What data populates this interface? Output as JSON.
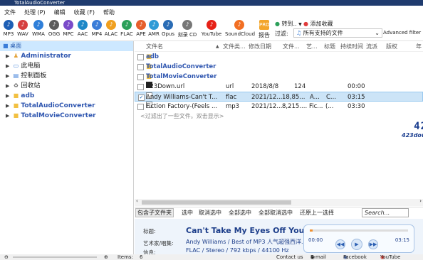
{
  "window": {
    "title": "TotalAudioConverter"
  },
  "menu": [
    "文件",
    "处理 (P)",
    "编辑",
    "收藏 (F)",
    "帮助"
  ],
  "formats": [
    {
      "label": "MP3",
      "icon": "mp3-icon",
      "color": "#1e5fb5"
    },
    {
      "label": "WAV",
      "icon": "wav-icon",
      "color": "#d64040"
    },
    {
      "label": "WMA",
      "icon": "wma-icon",
      "color": "#2f7fd9"
    },
    {
      "label": "OGG",
      "icon": "ogg-icon",
      "color": "#5b5b5b"
    },
    {
      "label": "MPC",
      "icon": "mpc-icon",
      "color": "#7a4bc9"
    },
    {
      "label": "AAC",
      "icon": "aac-icon",
      "color": "#1e88c7"
    },
    {
      "label": "MP4",
      "icon": "mp4-icon",
      "color": "#3b7dd8"
    },
    {
      "label": "ALAC",
      "icon": "alac-icon",
      "color": "#f0a020"
    },
    {
      "label": "FLAC",
      "icon": "flac-icon",
      "color": "#2ca05a"
    },
    {
      "label": "APE",
      "icon": "ape-icon",
      "color": "#e65f2b"
    },
    {
      "label": "AMR",
      "icon": "amr-icon",
      "color": "#2f9bd6"
    },
    {
      "label": "Opus",
      "icon": "opus-icon",
      "color": "#2a6cb5"
    },
    {
      "label": "刻录 CD",
      "icon": "burn-cd-icon",
      "color": "#777777"
    },
    {
      "label": "YouTube",
      "icon": "youtube-icon",
      "color": "#e62117"
    },
    {
      "label": "SoundCloud",
      "icon": "soundcloud-icon",
      "color": "#f26f23"
    }
  ],
  "toolbar": {
    "report_label": "报告",
    "convert_label": "转到..",
    "add_fav_label": "添加收藏",
    "filter_label": "过滤:",
    "filter_value": "所有支持的文件",
    "advanced_filter_label": "Advanced filter"
  },
  "tree": {
    "root": "桌面",
    "items": [
      {
        "label": "Administrator",
        "bold": true
      },
      {
        "label": "此电脑",
        "bold": false
      },
      {
        "label": "控制面板",
        "bold": false
      },
      {
        "label": "回收站",
        "bold": false
      },
      {
        "label": "adb",
        "bold": true
      },
      {
        "label": "TotalAudioConverter",
        "bold": true
      },
      {
        "label": "TotalMovieConverter",
        "bold": true
      }
    ]
  },
  "table": {
    "columns": [
      "文件名",
      "文件类...",
      "修改日期",
      "文件...",
      "艺...",
      "标题",
      "持续时间",
      "流派",
      "版权",
      "年"
    ],
    "rows": [
      {
        "name": "adb",
        "type": "",
        "date": "",
        "size": "",
        "artist": "",
        "title": "",
        "duration": "",
        "folder": true,
        "checked": false,
        "selected": false
      },
      {
        "name": "TotalAudioConverter",
        "type": "",
        "date": "",
        "size": "",
        "artist": "",
        "title": "",
        "duration": "",
        "folder": true,
        "checked": false,
        "selected": false
      },
      {
        "name": "TotalMovieConverter",
        "type": "",
        "date": "",
        "size": "",
        "artist": "",
        "title": "",
        "duration": "",
        "folder": true,
        "checked": false,
        "selected": false
      },
      {
        "name": "423Down.url",
        "type": "url",
        "date": "2018/8/8",
        "size": "124",
        "artist": "",
        "title": "",
        "duration": "00:00",
        "folder": false,
        "checked": false,
        "selected": false
      },
      {
        "name": "Andy Williams-Can't T...",
        "type": "flac",
        "date": "2021/12...",
        "size": "18,85...",
        "artist": "A...",
        "title": "C...",
        "duration": "03:15",
        "folder": false,
        "checked": true,
        "selected": true
      },
      {
        "name": "Fiction Factory-(Feels ...",
        "type": "mp3",
        "date": "2021/12...",
        "size": "8,215....",
        "artist": "Fic...",
        "title": "(...",
        "duration": "03:30",
        "folder": false,
        "checked": false,
        "selected": false
      }
    ],
    "hint": "<过滤出了一些文件。双击显示>"
  },
  "watermark": {
    "big": "423",
    "small": "423down.com"
  },
  "actions": {
    "include_subfolders": "包含子文件夹",
    "select": "选中",
    "deselect": "取消选中",
    "select_all": "全部选中",
    "deselect_all": "全部取消选中",
    "go_up": "还原上一选择",
    "search_placeholder": "Search..."
  },
  "info": {
    "title_label": "标题:",
    "artist_label": "艺术家/唱集:",
    "info_label": "信息:",
    "title": "Can't Take My Eyes Off You",
    "artist": "Andy Williams / Best of MP3 人气超强西洋...",
    "format": "FLAC / Stereo / 792 kbps / 44100 Hz",
    "time_start": "00:00",
    "time_end": "03:15",
    "progress": 0.03
  },
  "status": {
    "items_label": "Items:",
    "items_count": "6",
    "contact": "Contact us",
    "email": "E-mail",
    "facebook": "Facebook",
    "youtube": "YouTube"
  },
  "colors": {
    "accent": "#2b5eb2",
    "selection": "#cce4f7"
  }
}
